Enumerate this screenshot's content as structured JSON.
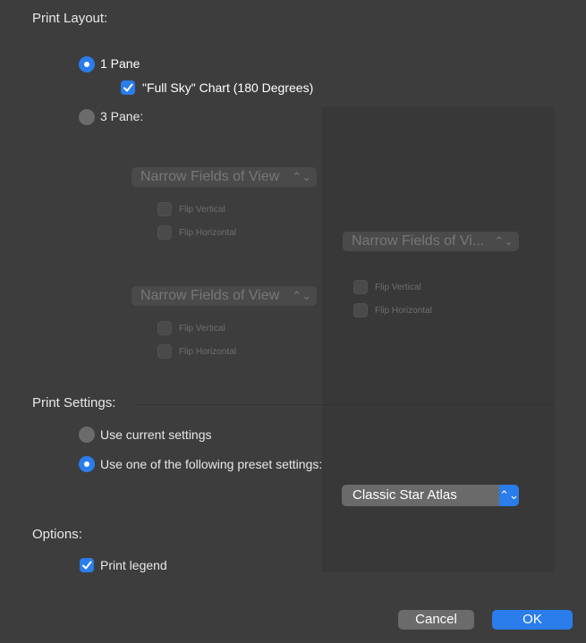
{
  "print_layout": {
    "title": "Print Layout:",
    "one_pane_label": "1 Pane",
    "full_sky_label": "\"Full Sky\" Chart (180 Degrees)",
    "three_pane_label": "3 Pane:",
    "pane_top": {
      "select": "Narrow Fields of View",
      "flip_vertical": "Flip Vertical",
      "flip_horizontal": "Flip Horizontal"
    },
    "pane_bottom": {
      "select": "Narrow Fields of View",
      "flip_vertical": "Flip Vertical",
      "flip_horizontal": "Flip Horizontal"
    },
    "pane_right": {
      "select": "Narrow Fields of Vi...",
      "flip_vertical": "Flip Vertical",
      "flip_horizontal": "Flip Horizontal"
    }
  },
  "print_settings": {
    "title": "Print Settings:",
    "use_current": "Use current settings",
    "use_preset": "Use one of the following preset settings:",
    "preset_value": "Classic Star Atlas"
  },
  "options": {
    "title": "Options:",
    "print_legend": "Print legend"
  },
  "buttons": {
    "cancel": "Cancel",
    "ok": "OK"
  },
  "colors": {
    "accent": "#2a7dea",
    "background": "#3d3d3d"
  }
}
